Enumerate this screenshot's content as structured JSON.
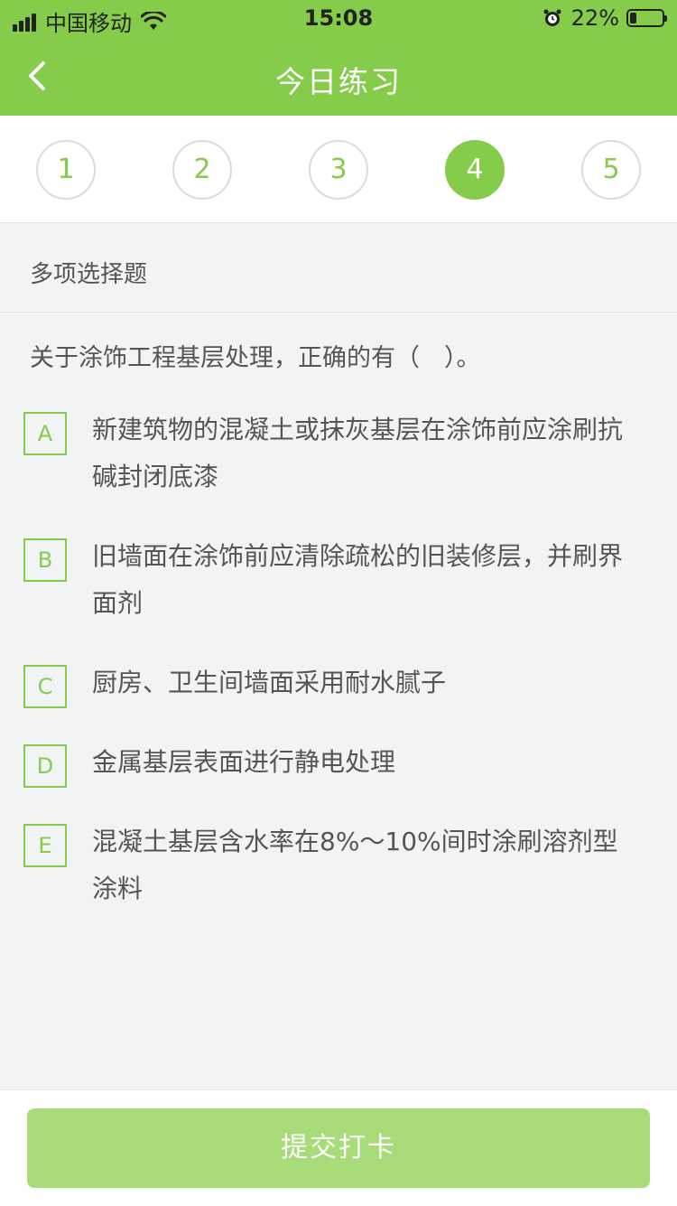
{
  "status": {
    "carrier": "中国移动",
    "time": "15:08",
    "battery": "22%",
    "battery_level": 0.22
  },
  "nav": {
    "title": "今日练习"
  },
  "steps": [
    "1",
    "2",
    "3",
    "4",
    "5"
  ],
  "active_step": 4,
  "question_type": "多项选择题",
  "question": "关于涂饰工程基层处理，正确的有（　）。",
  "options": [
    {
      "letter": "A",
      "text": "新建筑物的混凝土或抹灰基层在涂饰前应涂刷抗碱封闭底漆"
    },
    {
      "letter": "B",
      "text": "旧墙面在涂饰前应清除疏松的旧装修层，并刷界面剂"
    },
    {
      "letter": "C",
      "text": "厨房、卫生间墙面采用耐水腻子"
    },
    {
      "letter": "D",
      "text": "金属基层表面进行静电处理"
    },
    {
      "letter": "E",
      "text": "混凝土基层含水率在8%～10%间时涂刷溶剂型涂料"
    }
  ],
  "submit_label": "提交打卡",
  "colors": {
    "accent": "#86cc4b",
    "submit": "#a7dc79"
  }
}
